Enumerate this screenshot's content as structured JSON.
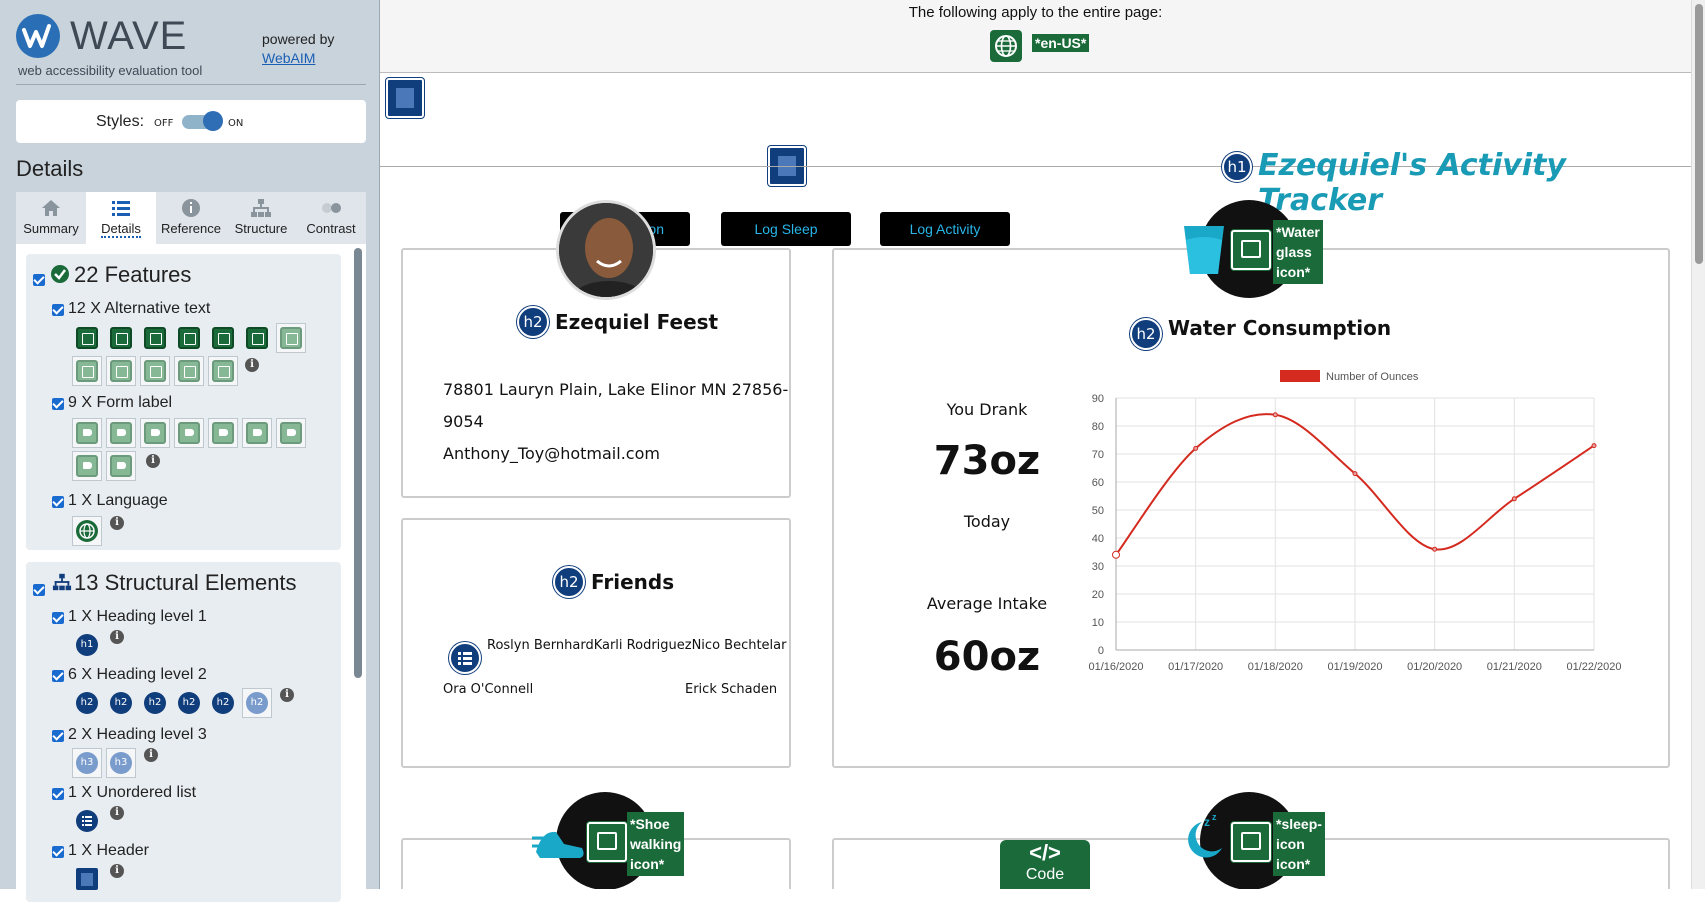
{
  "wave": {
    "title": "WAVE",
    "subtitle": "web accessibility evaluation tool",
    "powered_by": "powered by",
    "webaim_link": "WebAIM",
    "styles_label": "Styles:",
    "styles_off": "OFF",
    "styles_on": "ON",
    "details_heading": "Details",
    "tabs": [
      {
        "label": "Summary",
        "icon": "home-icon"
      },
      {
        "label": "Details",
        "icon": "list-icon"
      },
      {
        "label": "Reference",
        "icon": "info-icon"
      },
      {
        "label": "Structure",
        "icon": "hierarchy-icon"
      },
      {
        "label": "Contrast",
        "icon": "contrast-icon"
      }
    ],
    "active_tab": "Details",
    "features": {
      "title": "22 Features",
      "rows": [
        {
          "label": "12 X Alternative text",
          "count": 12
        },
        {
          "label": "9 X Form label",
          "count": 9
        },
        {
          "label": "1 X Language",
          "count": 1
        }
      ]
    },
    "structure": {
      "title": "13 Structural Elements",
      "rows": [
        {
          "label": "1 X Heading level 1",
          "badges": [
            "h1"
          ]
        },
        {
          "label": "6 X Heading level 2",
          "badges": [
            "h2",
            "h2",
            "h2",
            "h2",
            "h2",
            "h2"
          ]
        },
        {
          "label": "2 X Heading level 3",
          "badges": [
            "h3",
            "h3"
          ]
        },
        {
          "label": "1 X Unordered list",
          "badges": []
        },
        {
          "label": "1 X Header",
          "badges": []
        }
      ]
    },
    "info_glyph": "i"
  },
  "page": {
    "banner_text": "The following apply to the entire page:",
    "lang_tag": "*en-US*",
    "h1_badge": "h1",
    "h2_badge": "h2",
    "title": "Ezequiel's Activity Tracker",
    "nav_buttons": [
      "Log Hydration",
      "Log Sleep",
      "Log Activity"
    ],
    "nav_button_partial": "on",
    "user": {
      "name": "Ezequiel Feest",
      "address_line1": "78801 Lauryn Plain, Lake Elinor MN 27856-",
      "address_line2": "9054",
      "email": "Anthony_Toy@hotmail.com"
    },
    "friends": {
      "heading": "Friends",
      "row1": "Roslyn BernhardKarli RodriguezNico Bechtelar",
      "row2_left": "Ora O'Connell",
      "row2_right": "Erick Schaden"
    },
    "water": {
      "heading": "Water Consumption",
      "you_drank_label": "You Drank",
      "today_value": "73oz",
      "today_label": "Today",
      "average_label": "Average Intake",
      "average_value": "60oz",
      "icon_alt": [
        "*Water",
        "glass",
        "icon*"
      ]
    },
    "shoe_alt": [
      "*Shoe",
      "walking",
      "icon*"
    ],
    "sleep_alt": [
      "*sleep-",
      "icon",
      "icon*"
    ],
    "code_label": "Code",
    "code_glyph": "</>"
  },
  "colors": {
    "accent_teal": "#1a9bb5",
    "wave_green": "#1b6b3a",
    "wave_blue": "#103d7c",
    "chart_line": "#d42a1f",
    "button_text": "#29b5e8"
  },
  "chart_data": {
    "type": "line",
    "x": [
      "01/16/2020",
      "01/17/2020",
      "01/18/2020",
      "01/19/2020",
      "01/20/2020",
      "01/21/2020",
      "01/22/2020"
    ],
    "series": [
      {
        "name": "Number of Ounces",
        "values": [
          34,
          72,
          84,
          63,
          36,
          54,
          73
        ]
      }
    ],
    "ylim": [
      0,
      90
    ],
    "yticks": [
      0,
      10,
      20,
      30,
      40,
      50,
      60,
      70,
      80,
      90
    ],
    "grid": true,
    "legend": "top-center",
    "title": "",
    "xlabel": "",
    "ylabel": ""
  }
}
